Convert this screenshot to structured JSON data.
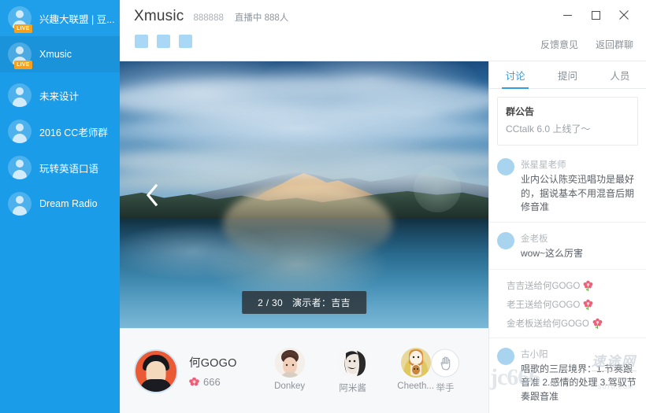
{
  "sidebar": {
    "items": [
      {
        "label": "兴趣大联盟 | 豆...",
        "live": true,
        "live_text": "LIVE",
        "active": false
      },
      {
        "label": "Xmusic",
        "live": true,
        "live_text": "LIVE",
        "active": true
      },
      {
        "label": "未来设计",
        "live": false,
        "live_text": "",
        "active": false
      },
      {
        "label": "2016 CC老师群",
        "live": false,
        "live_text": "",
        "active": false
      },
      {
        "label": "玩转英语口语",
        "live": false,
        "live_text": "",
        "active": false
      },
      {
        "label": "Dream Radio",
        "live": false,
        "live_text": "",
        "active": false
      }
    ]
  },
  "titlebar": {
    "room_name": "Xmusic",
    "room_id": "888888",
    "live_status": "直播中 888人",
    "minimize_label": "最小化",
    "maximize_label": "最大化",
    "close_label": "关闭",
    "feedback_label": "反馈意见",
    "back_label": "返回群聊",
    "toolbar_icons": [
      "tool-icon-1",
      "tool-icon-2",
      "tool-icon-3"
    ]
  },
  "stage": {
    "prev_label": "上一页",
    "slide_page": "2 / 30",
    "presenter_text": "演示者：吉吉"
  },
  "presenter_bar": {
    "host": {
      "name": "何GOGO",
      "gift_count": "666",
      "gift_icon": "flower-icon"
    },
    "members": [
      {
        "name": "Donkey"
      },
      {
        "name": "阿米酱"
      },
      {
        "name": "Cheeth..."
      }
    ],
    "raise_hand": {
      "label": "举手",
      "icon": "hand-icon"
    }
  },
  "chat": {
    "tabs": [
      {
        "label": "讨论",
        "active": true
      },
      {
        "label": "提问",
        "active": false
      },
      {
        "label": "人员",
        "active": false
      }
    ],
    "notice": {
      "title": "群公告",
      "body": "CCtalk 6.0 上线了～"
    },
    "messages": [
      {
        "user": "张星星老师",
        "text": "业内公认陈奕迅唱功是最好的，据说基本不用混音后期修音准"
      },
      {
        "user": "金老板",
        "text": "wow~这么厉害"
      }
    ],
    "gifts": [
      {
        "text": "吉吉送给何GOGO",
        "icon": "flower-icon"
      },
      {
        "text": "老王送给何GOGO",
        "icon": "flower-icon"
      },
      {
        "text": "金老板送给何GOGO",
        "icon": "flower-icon"
      }
    ],
    "messages_bottom": [
      {
        "user": "古小阳",
        "text": "唱歌的三层境界：1.节奏跟音准 2.感情的处理 3.驾驭节奏跟音准"
      }
    ]
  },
  "watermark": {
    "cn": "速途网",
    "en": "jc666",
    "sub": "SUTU.COM"
  },
  "colors": {
    "sidebar_bg": "#1a9ce8",
    "accent": "#2f9fe0",
    "live_badge": "#f5a01e",
    "gift_red": "#e8566e"
  }
}
